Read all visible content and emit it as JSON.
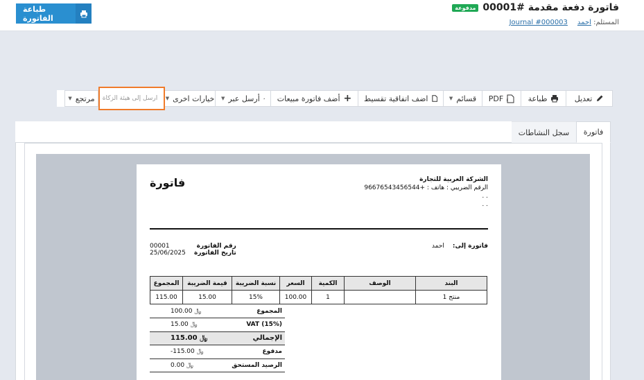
{
  "header": {
    "title": "فاتورة دفعة مقدمة #00001",
    "status": "مدفوعة",
    "print_label": "طباعة الفاتورة",
    "receiver_label": "المستلم:",
    "receiver_name": "احمد",
    "journal_link": "Journal #000003"
  },
  "toolbar": {
    "edit": "تعديل",
    "print": "طباعة",
    "pdf": "PDF",
    "vouchers": "قسائم",
    "installment": "اضف اتفاقية تقسيط",
    "add_sales_invoice": "أضف فاتورة مبيعات",
    "send_via": "أرسل عبر",
    "more_options": "خيارات اخرى",
    "send_to_zakat": "ارسل إلى هيئة الزكاة",
    "returned": "مرتجع"
  },
  "tabs": {
    "invoice": "فاتورة",
    "activity_log": "سجل النشاطات"
  },
  "invoice": {
    "doc_title": "فاتورة",
    "company_name": "الشركة العربية للتجارة",
    "tax_line": "الرقم الضريبي : هاتف : +96676543456544",
    "company_line2": ". .",
    "company_line3": ". .",
    "invoice_number_label": "رقم الفاتورة",
    "invoice_number": "00001",
    "invoice_date_label": "تاريخ الفاتورة",
    "invoice_date": "25/06/2025",
    "bill_to_label": "فاتورة إلى:",
    "bill_to_name": "احمد",
    "columns": {
      "item": "البند",
      "description": "الوصف",
      "qty": "الكمية",
      "price": "السعر",
      "tax_rate": "نسبة الضريبة",
      "tax_value": "قيمة الضريبة",
      "total": "المجموع"
    },
    "rows": [
      {
        "item": "منتج 1",
        "description": "",
        "qty": "1",
        "price": "100.00",
        "tax_rate": "15%",
        "tax_value": "15.00",
        "total": "115.00"
      }
    ],
    "totals": [
      {
        "label": "المجموع",
        "value": "100.00 ﷼"
      },
      {
        "label": "VAT (15%)",
        "value": "15.00 ﷼"
      },
      {
        "label": "الإجمالي",
        "value": "115.00 ﷼"
      },
      {
        "label": "مدفوع",
        "value": "-115.00 ﷼"
      },
      {
        "label": "الرصيد المستحق",
        "value": "0.00 ﷼"
      }
    ]
  }
}
